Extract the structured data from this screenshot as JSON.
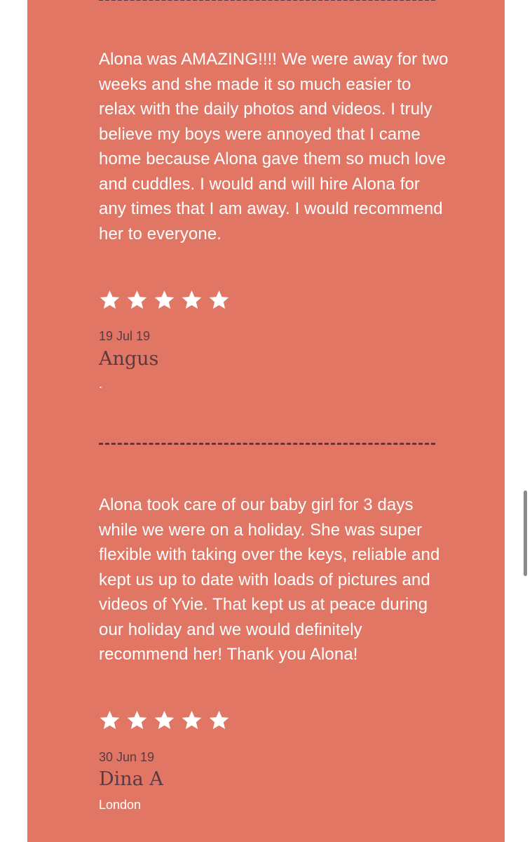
{
  "colors": {
    "panel": "#e27665",
    "text": "#ffffff",
    "accent": "#5a3a42"
  },
  "reviews": [
    {
      "text": "Alona was AMAZING!!!! We were away for two weeks and she made it so much easier to relax with the daily photos and videos. I truly believe my boys were annoyed that I came home because Alona gave them so much love and cuddles. I would and will hire Alona for any times that I am away. I would recommend her to everyone.",
      "rating": 5,
      "date": "19 Jul 19",
      "author": "Angus",
      "location": "."
    },
    {
      "text": "Alona took care of our baby girl for 3 days while we were on a holiday. She was super flexible with taking over the keys, reliable and kept us up to date with loads of pictures and videos of Yvie. That kept us at peace during our holiday and we would definitely recommend her! Thank you Alona!",
      "rating": 5,
      "date": "30 Jun 19",
      "author": "Dina A",
      "location": "London"
    }
  ],
  "icons": {
    "star": "star-icon"
  }
}
